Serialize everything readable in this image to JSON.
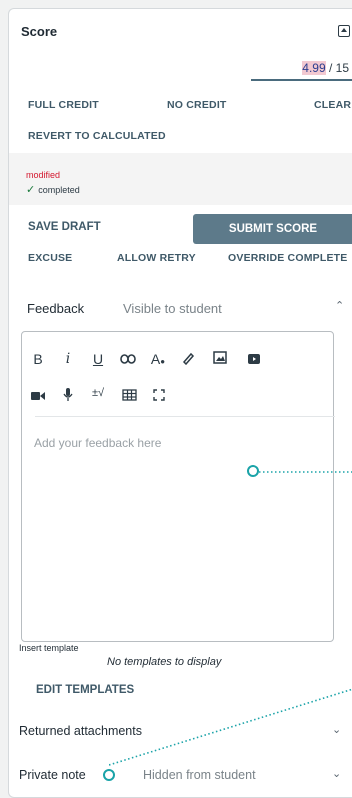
{
  "score": {
    "title": "Score",
    "value": "4.99",
    "max": " / 15"
  },
  "credit_actions": {
    "full_credit": "FULL CREDIT",
    "no_credit": "NO CREDIT",
    "clear": "CLEAR",
    "revert": "REVERT TO CALCULATED"
  },
  "status": {
    "modified": "modified",
    "completed": "completed"
  },
  "actions": {
    "save_draft": "SAVE DRAFT",
    "submit_score": "SUBMIT SCORE",
    "excuse": "EXCUSE",
    "allow_retry": "ALLOW RETRY",
    "override_complete": "OVERRIDE COMPLETE"
  },
  "feedback": {
    "label": "Feedback",
    "visibility": "Visible to student",
    "placeholder": "Add your feedback here",
    "toolbar_icons": [
      "bold-icon",
      "italic-icon",
      "underline-icon",
      "link-icon",
      "text-color-icon",
      "highlight-icon",
      "image-icon",
      "youtube-icon",
      "video-icon",
      "microphone-icon",
      "math-icon",
      "table-icon",
      "fullscreen-icon"
    ]
  },
  "templates": {
    "insert_label": "Insert template",
    "empty_message": "No templates to display",
    "edit_label": "EDIT TEMPLATES"
  },
  "returned_attachments": {
    "label": "Returned attachments"
  },
  "private_note": {
    "label": "Private note",
    "visibility": "Hidden from student"
  },
  "colors": {
    "submit_button": "#5d7a8a",
    "modified_text": "#d4172e",
    "annotation_dot": "#1aa3a8"
  }
}
